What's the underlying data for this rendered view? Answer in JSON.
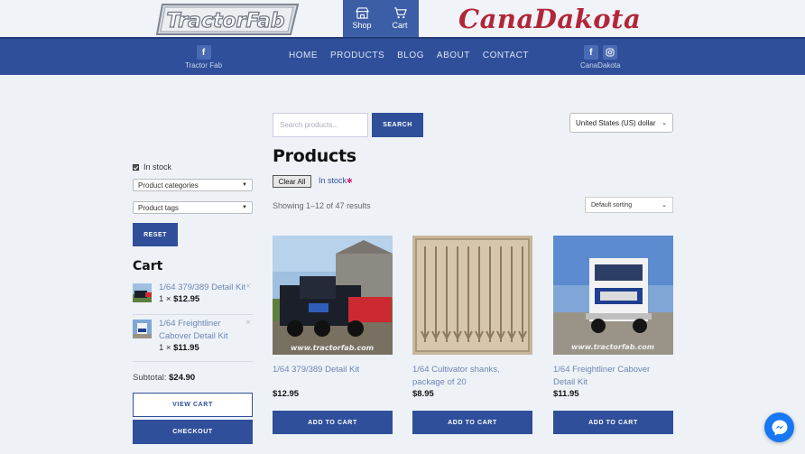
{
  "header": {
    "logo_left": "TractorFab",
    "logo_right": "CanaDakota",
    "shop_label": "Shop",
    "cart_label": "Cart"
  },
  "nav": {
    "social_left_label": "Tractor Fab",
    "social_right_label": "CanaDakota",
    "links": [
      "HOME",
      "PRODUCTS",
      "BLOG",
      "ABOUT",
      "CONTACT"
    ]
  },
  "search": {
    "placeholder": "Search products...",
    "button": "SEARCH"
  },
  "currency": {
    "selected": "United States (US) dollar"
  },
  "main": {
    "title": "Products",
    "clear_all": "Clear All",
    "active_filter": "In stock",
    "result_count": "Showing 1–12 of 47 results",
    "sorting": "Default sorting"
  },
  "products": [
    {
      "name": "1/64 379/389 Detail Kit",
      "price": "$12.95",
      "button": "ADD TO CART"
    },
    {
      "name": "1/64 Cultivator shanks, package of 20",
      "price": "$8.95",
      "button": "ADD TO CART"
    },
    {
      "name": "1/64 Freightliner Cabover Detail Kit",
      "price": "$11.95",
      "button": "ADD TO CART"
    }
  ],
  "sidebar": {
    "instock_label": "In stock",
    "categories_select": "Product categories",
    "tags_select": "Product tags",
    "reset": "RESET",
    "cart_title": "Cart",
    "cart_items": [
      {
        "name": "1/64 379/389 Detail Kit",
        "qty": "1 ×",
        "price": "$12.95"
      },
      {
        "name": "1/64 Freightliner Cabover Detail Kit",
        "qty": "1 ×",
        "price": "$11.95"
      }
    ],
    "subtotal_label": "Subtotal:",
    "subtotal_value": "$24.90",
    "view_cart": "VIEW CART",
    "checkout": "CHECKOUT"
  },
  "watermark": "www.tractorfab.com",
  "colors": {
    "primary": "#2f4f9a",
    "nav": "#2f4f9a",
    "brand_red": "#b2263a",
    "link": "#6d86b3",
    "background": "#eef2f7"
  }
}
